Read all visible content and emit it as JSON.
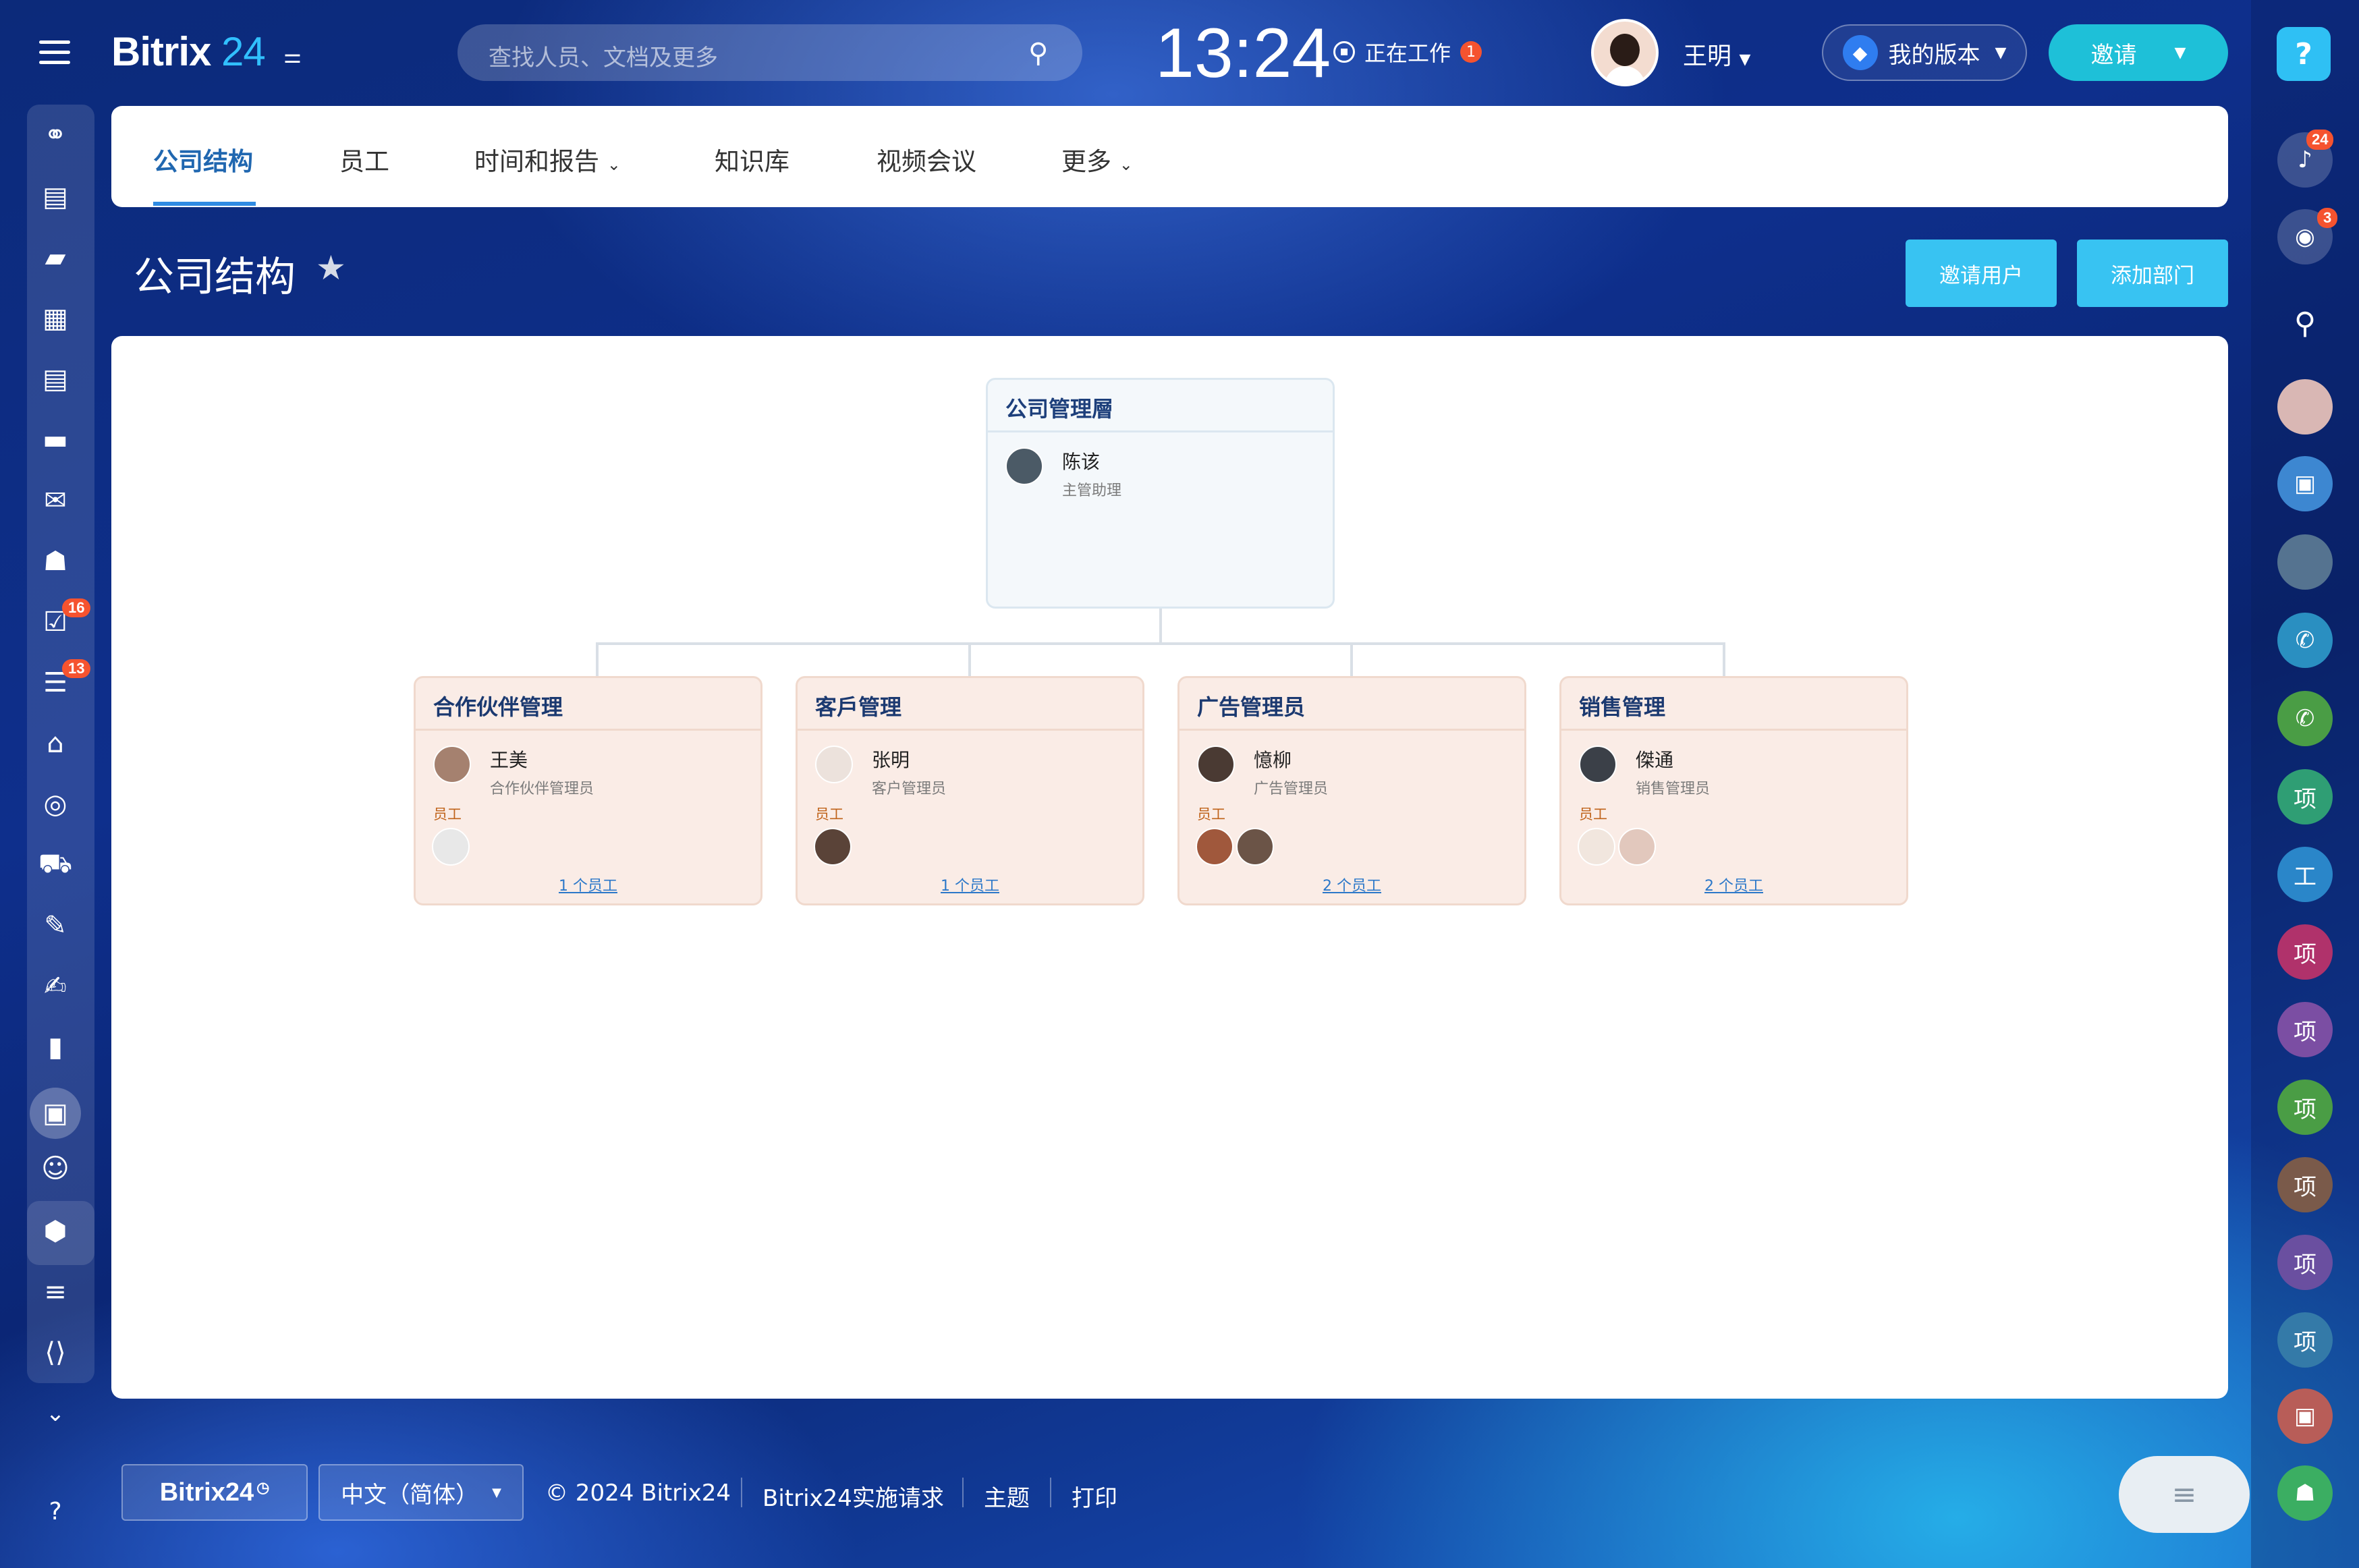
{
  "app": {
    "logo_name": "Bitrix",
    "logo_number": "24"
  },
  "topbar": {
    "search_placeholder": "查找人员、文档及更多",
    "clock": "13:24",
    "working_status": "正在工作",
    "working_badge": "1",
    "user_name": "王明",
    "plan_label": "我的版本",
    "invite_label": "邀请"
  },
  "tabs": [
    {
      "label": "公司结构",
      "active": true
    },
    {
      "label": "员工"
    },
    {
      "label": "时间和报告",
      "has_dropdown": true
    },
    {
      "label": "知识库"
    },
    {
      "label": "视频会议"
    },
    {
      "label": "更多",
      "has_dropdown": true
    }
  ],
  "page": {
    "title": "公司结构",
    "invite_user_button": "邀请用户",
    "add_department_button": "添加部门"
  },
  "org": {
    "top": {
      "title": "公司管理層",
      "manager_name": "陈该",
      "manager_role": "主管助理"
    },
    "departments": [
      {
        "title": "合作伙伴管理",
        "manager_name": "王美",
        "manager_role": "合作伙伴管理员",
        "employees_label": "员工",
        "count_label": "1 个员工"
      },
      {
        "title": "客戶管理",
        "manager_name": "张明",
        "manager_role": "客户管理员",
        "employees_label": "员工",
        "count_label": "1 个员工"
      },
      {
        "title": "广告管理员",
        "manager_name": "憶柳",
        "manager_role": "广告管理员",
        "employees_label": "员工",
        "count_label": "2 个员工"
      },
      {
        "title": "销售管理",
        "manager_name": "傑通",
        "manager_role": "销售管理员",
        "employees_label": "员工",
        "count_label": "2 个员工"
      }
    ]
  },
  "left_sidebar": {
    "badges": {
      "tasks": "16",
      "feed": "13"
    }
  },
  "right_sidebar": {
    "notifications_badge": "24",
    "chat_badge": "3",
    "project_chats": [
      "项",
      "工",
      "项",
      "项",
      "项",
      "项",
      "项",
      "项"
    ],
    "project_colors": [
      "#2f9e74",
      "#2a86c9",
      "#b0326b",
      "#7b4ea3",
      "#4a9d45",
      "#7a5a4a",
      "#6a4fa0",
      "#347aa8"
    ]
  },
  "footer": {
    "brand_button": "Bitrix24",
    "language": "中文（简体）",
    "copyright": "© 2024 Bitrix24",
    "links": [
      "Bitrix24实施请求",
      "主题",
      "打印"
    ]
  }
}
